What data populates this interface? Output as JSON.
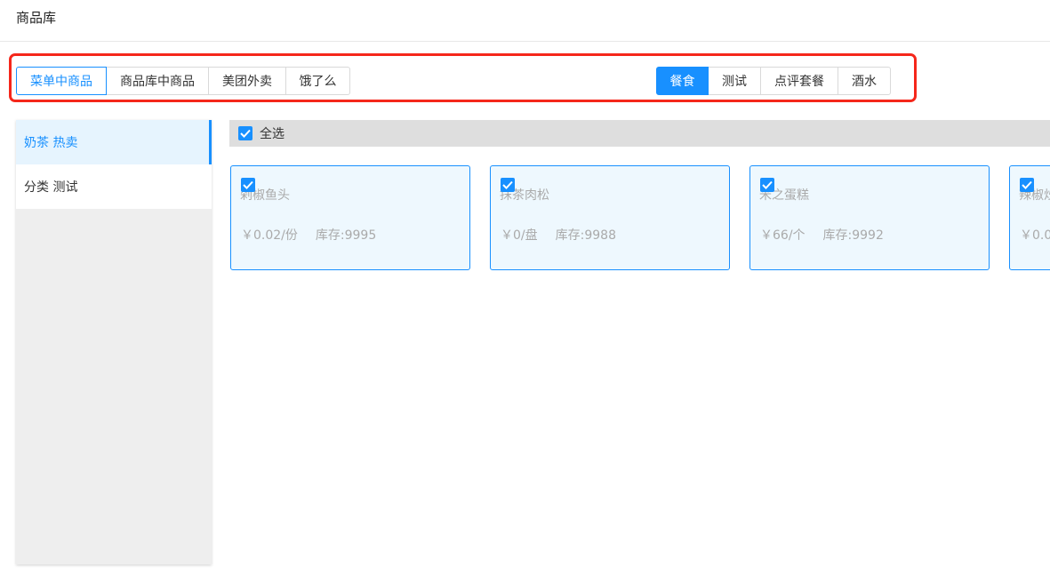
{
  "page": {
    "title": "商品库"
  },
  "source_tabs": [
    {
      "label": "菜单中商品",
      "active": true
    },
    {
      "label": "商品库中商品",
      "active": false
    },
    {
      "label": "美团外卖",
      "active": false
    },
    {
      "label": "饿了么",
      "active": false
    }
  ],
  "category_tabs": [
    {
      "label": "餐食",
      "active": true
    },
    {
      "label": "测试",
      "active": false
    },
    {
      "label": "点评套餐",
      "active": false
    },
    {
      "label": "酒水",
      "active": false
    }
  ],
  "sidebar": {
    "items": [
      {
        "label": "奶茶 热卖",
        "active": true
      },
      {
        "label": "分类 测试",
        "active": false
      }
    ]
  },
  "select_all": {
    "label": "全选",
    "checked": true
  },
  "products": [
    {
      "name": "剁椒鱼头",
      "price": "￥0.02/份",
      "stock": "库存:9995",
      "checked": true
    },
    {
      "name": "抹茶肉松",
      "price": "￥0/盘",
      "stock": "库存:9988",
      "checked": true
    },
    {
      "name": "米之蛋糕",
      "price": "￥66/个",
      "stock": "库存:9992",
      "checked": true
    },
    {
      "name": "辣椒炒",
      "price": "￥0.0",
      "stock": "",
      "checked": true
    }
  ],
  "colors": {
    "accent": "#1890ff",
    "highlight": "#f5271b",
    "card_bg": "#eef8fe",
    "sidebar_active_bg": "#e6f4fe"
  }
}
